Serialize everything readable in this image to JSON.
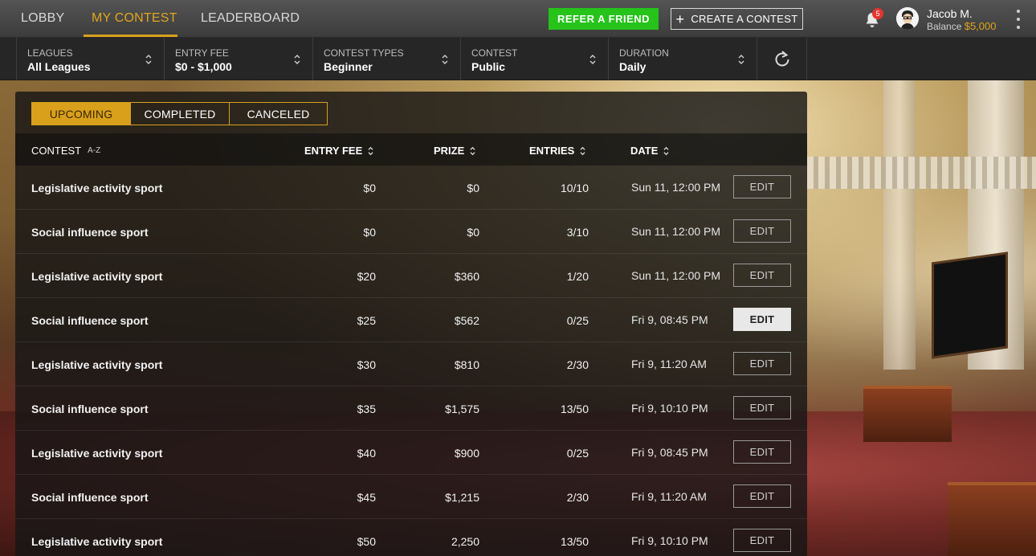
{
  "nav": {
    "tabs": [
      {
        "label": "LOBBY"
      },
      {
        "label": "MY CONTEST"
      },
      {
        "label": "LEADERBOARD"
      }
    ],
    "refer_label": "REFER A FRIEND",
    "create_label": "CREATE A CONTEST",
    "notification_count": "5",
    "user": {
      "name": "Jacob M.",
      "balance_label": "Balance",
      "balance_value": "$5,000"
    }
  },
  "filters": [
    {
      "label": "LEAGUES",
      "value": "All Leagues"
    },
    {
      "label": "ENTRY FEE",
      "value": "$0 - $1,000"
    },
    {
      "label": "CONTEST TYPES",
      "value": "Beginner"
    },
    {
      "label": "CONTEST",
      "value": "Public"
    },
    {
      "label": "DURATION",
      "value": "Daily"
    }
  ],
  "segments": {
    "upcoming": "UPCOMING",
    "completed": "COMPLETED",
    "canceled": "CANCELED"
  },
  "table": {
    "headers": {
      "contest": "CONTEST",
      "contest_sort": "A-Z",
      "entry_fee": "ENTRY FEE",
      "prize": "PRIZE",
      "entries": "ENTRIES",
      "date": "DATE"
    },
    "edit_label": "EDIT",
    "rows": [
      {
        "name": "Legislative activity sport",
        "fee": "$0",
        "prize": "$0",
        "entries": "10/10",
        "date": "Sun 11, 12:00 PM"
      },
      {
        "name": "Social influence sport",
        "fee": "$0",
        "prize": "$0",
        "entries": "3/10",
        "date": "Sun 11, 12:00 PM"
      },
      {
        "name": "Legislative activity sport",
        "fee": "$20",
        "prize": "$360",
        "entries": "1/20",
        "date": "Sun 11, 12:00 PM"
      },
      {
        "name": "Social influence sport",
        "fee": "$25",
        "prize": "$562",
        "entries": "0/25",
        "date": "Fri 9, 08:45 PM"
      },
      {
        "name": "Legislative activity sport",
        "fee": "$30",
        "prize": "$810",
        "entries": "2/30",
        "date": "Fri 9, 11:20 AM"
      },
      {
        "name": "Social influence sport",
        "fee": "$35",
        "prize": "$1,575",
        "entries": "13/50",
        "date": "Fri 9, 10:10 PM"
      },
      {
        "name": "Legislative activity sport",
        "fee": "$40",
        "prize": "$900",
        "entries": "0/25",
        "date": "Fri 9, 08:45 PM"
      },
      {
        "name": "Social influence sport",
        "fee": "$45",
        "prize": "$1,215",
        "entries": "2/30",
        "date": "Fri 9, 11:20 AM"
      },
      {
        "name": "Legislative activity sport",
        "fee": "$50",
        "prize": "2,250",
        "entries": "13/50",
        "date": "Fri 9, 10:10 PM"
      }
    ]
  },
  "colors": {
    "accent": "#d9a01b",
    "refer": "#26c31b",
    "badge": "#e2362f"
  }
}
